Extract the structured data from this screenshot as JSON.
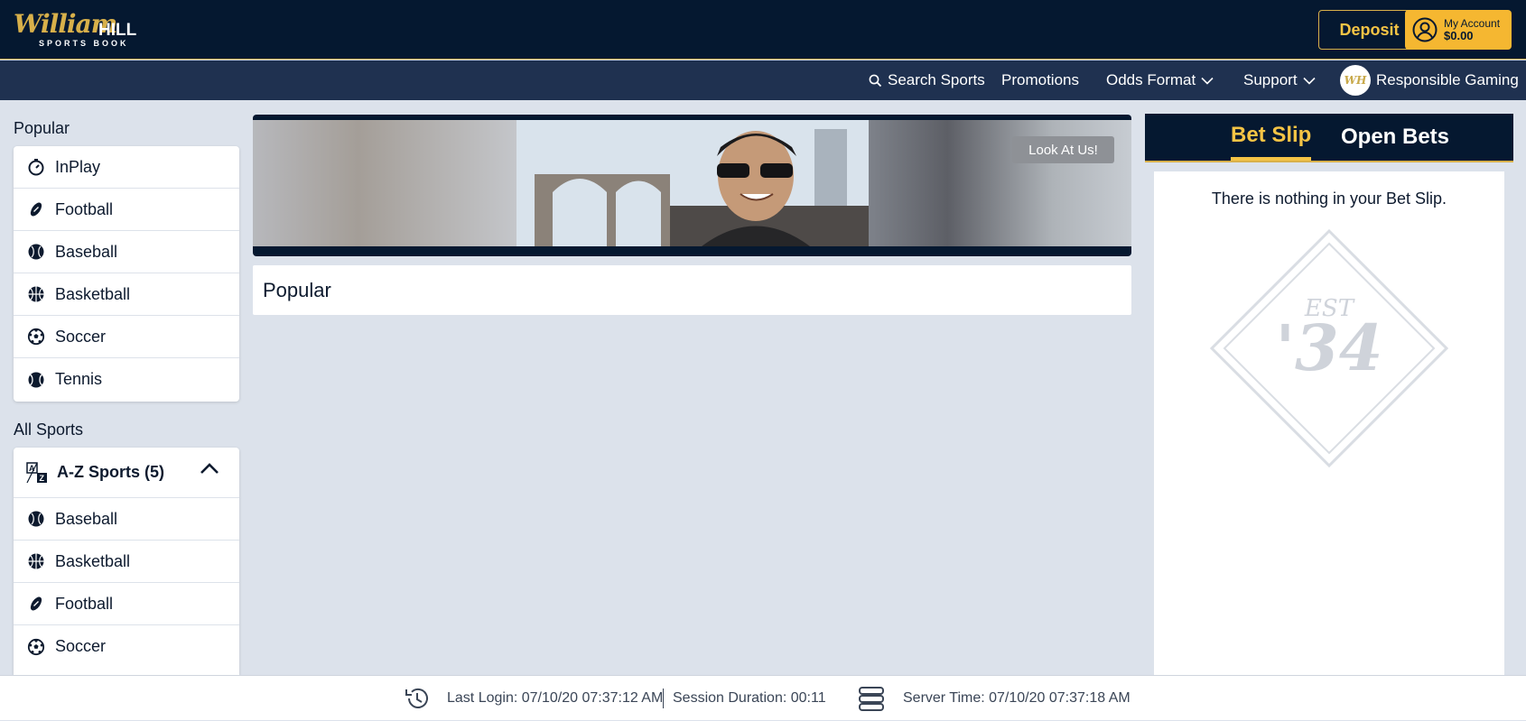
{
  "header": {
    "logo": {
      "script": "William",
      "bold": "HILL",
      "sub": "SPORTS BOOK"
    },
    "deposit_label": "Deposit",
    "account": {
      "label": "My Account",
      "balance": "$0.00"
    }
  },
  "nav": {
    "search": "Search Sports",
    "promotions": "Promotions",
    "odds_format": "Odds Format",
    "support": "Support",
    "responsible_gaming": "Responsible Gaming",
    "rg_logo_text": "WH"
  },
  "sidebar": {
    "popular_title": "Popular",
    "popular_items": [
      {
        "label": "InPlay",
        "icon": "stopwatch-icon"
      },
      {
        "label": "Football",
        "icon": "football-icon"
      },
      {
        "label": "Baseball",
        "icon": "baseball-icon"
      },
      {
        "label": "Basketball",
        "icon": "basketball-icon"
      },
      {
        "label": "Soccer",
        "icon": "soccer-ball-icon"
      },
      {
        "label": "Tennis",
        "icon": "tennis-ball-icon"
      }
    ],
    "all_sports_title": "All Sports",
    "az_label": "A-Z Sports (5)",
    "az_items": [
      {
        "label": "Baseball",
        "icon": "baseball-icon"
      },
      {
        "label": "Basketball",
        "icon": "basketball-icon"
      },
      {
        "label": "Football",
        "icon": "football-icon"
      },
      {
        "label": "Soccer",
        "icon": "soccer-ball-icon"
      }
    ]
  },
  "main": {
    "banner_button": "Look At Us!",
    "popular_heading": "Popular"
  },
  "betslip": {
    "tab_betslip": "Bet Slip",
    "tab_openbets": "Open Bets",
    "empty_message": "There is nothing in your Bet Slip.",
    "emblem_top": "EST",
    "emblem_year": "'34"
  },
  "footer": {
    "last_login": "Last Login: 07/10/20 07:37:12 AM",
    "session_duration": "Session Duration: 00:11",
    "server_time": "Server Time: 07/10/20 07:37:18 AM"
  },
  "colors": {
    "header_bg": "#051830",
    "nav_bg": "#1f3150",
    "gold": "#f5c445",
    "page_bg": "#dce2eb"
  }
}
